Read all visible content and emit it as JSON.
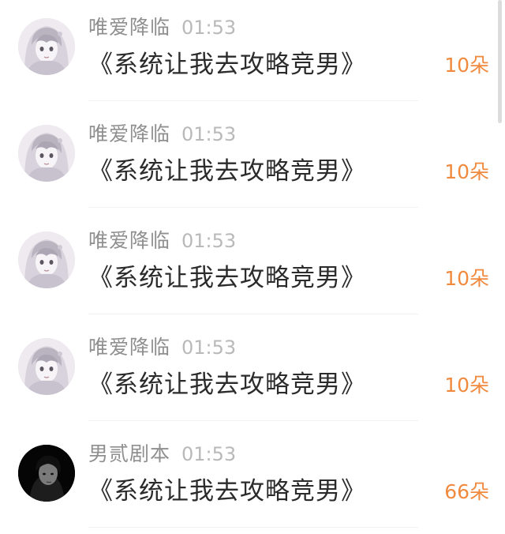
{
  "messages": [
    {
      "user": "唯爱降临",
      "time": "01:53",
      "text": "《系统让我去攻略竞男》",
      "gift": "10朵",
      "avatar": "anime-girl-avatar"
    },
    {
      "user": "唯爱降临",
      "time": "01:53",
      "text": "《系统让我去攻略竞男》",
      "gift": "10朵",
      "avatar": "anime-girl-avatar"
    },
    {
      "user": "唯爱降临",
      "time": "01:53",
      "text": "《系统让我去攻略竞男》",
      "gift": "10朵",
      "avatar": "anime-girl-avatar"
    },
    {
      "user": "唯爱降临",
      "time": "01:53",
      "text": "《系统让我去攻略竞男》",
      "gift": "10朵",
      "avatar": "anime-girl-avatar"
    },
    {
      "user": "男贰剧本",
      "time": "01:53",
      "text": "《系统让我去攻略竞男》",
      "gift": "66朵",
      "avatar": "dark-portrait-avatar"
    }
  ],
  "colors": {
    "gift_accent": "#ef8a3f",
    "username": "#8f8f8f",
    "timestamp": "#b9b9b9",
    "message_text": "#2b2b2b"
  }
}
